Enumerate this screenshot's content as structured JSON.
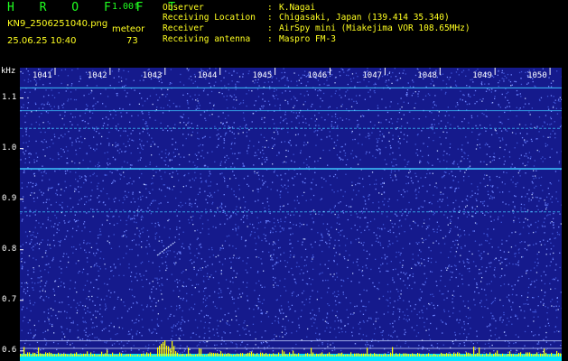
{
  "header": {
    "title": "H R O F F T",
    "version": "1.00f",
    "filename": "KN9_2506251040.png",
    "datetime": "25.06.25 10:40",
    "meteor_label": "meteor",
    "meteor_count": "73"
  },
  "info": [
    {
      "label": "Observer",
      "value": "K.Nagai"
    },
    {
      "label": "Receiving Location",
      "value": "Chigasaki, Japan (139.414 35.340)"
    },
    {
      "label": "Receiver",
      "value": "AirSpy mini (Miakejima VOR 108.65MHz)"
    },
    {
      "label": "Receiving antenna",
      "value": "Maspro FM-3"
    }
  ],
  "separator": ":",
  "spectrogram": {
    "y_unit": "kHz",
    "y_ticks": [
      "1.1",
      "1.0",
      "0.9",
      "0.8",
      "0.7",
      "0.6"
    ],
    "x_ticks": [
      "1041",
      "1042",
      "1043",
      "1044",
      "1045",
      "1046",
      "1047",
      "1048",
      "1049",
      "1050"
    ],
    "y_range_khz": [
      0.58,
      1.16
    ],
    "horizontal_lines_khz": [
      1.12,
      1.075,
      1.04,
      0.96,
      0.875,
      0.62,
      0.605
    ],
    "colors": {
      "background": "#151a8c",
      "noise": "#6f86ff",
      "line": "#3ec8ff",
      "bottom_band": "#00e5ff",
      "spikes": "#ffff00"
    }
  }
}
